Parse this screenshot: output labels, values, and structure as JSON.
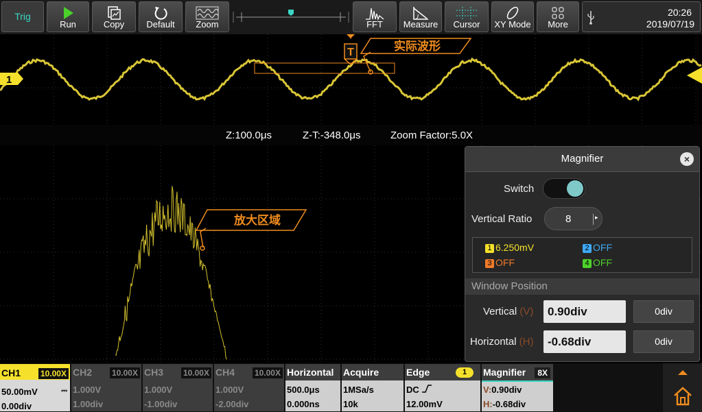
{
  "toolbar": {
    "trig": "Trig",
    "buttons": [
      {
        "label": "Run",
        "icon": "play-icon"
      },
      {
        "label": "Copy",
        "icon": "copy-icon"
      },
      {
        "label": "Default",
        "icon": "reset-icon"
      },
      {
        "label": "Zoom",
        "icon": "zoom-wave-icon"
      },
      {
        "label": "FFT",
        "icon": "fft-icon"
      },
      {
        "label": "Measure",
        "icon": "measure-icon"
      },
      {
        "label": "Cursor",
        "icon": "cursor-icon"
      },
      {
        "label": "XY Mode",
        "icon": "xy-icon"
      },
      {
        "label": "More",
        "icon": "grid-icon"
      }
    ],
    "time": "20:26",
    "date": "2019/07/19"
  },
  "overview": {
    "annotation": "实际波形",
    "trigger_marker": "T",
    "channel_marker": "1"
  },
  "zoom_info": {
    "z": "Z:100.0μs",
    "zt": "Z-T:-348.0μs",
    "factor": "Zoom Factor:5.0X"
  },
  "main": {
    "annotation": "放大区域"
  },
  "magnifier": {
    "title": "Magnifier",
    "switch_label": "Switch",
    "switch_on": true,
    "ratio_label": "Vertical Ratio",
    "ratio_value": "8",
    "channels": [
      {
        "num": "1",
        "value": "6.250mV",
        "color": "#f5e12b"
      },
      {
        "num": "2",
        "value": "OFF",
        "color": "#3fa9f5"
      },
      {
        "num": "3",
        "value": "OFF",
        "color": "#f07a2a"
      },
      {
        "num": "4",
        "value": "OFF",
        "color": "#4ed12a"
      }
    ],
    "section": "Window Position",
    "vertical_label": "Vertical",
    "vertical_key": "(V)",
    "vertical_value": "0.90div",
    "vertical_zero": "0div",
    "horizontal_label": "Horizontal",
    "horizontal_key": "(H)",
    "horizontal_value": "-0.68div",
    "horizontal_zero": "0div"
  },
  "status": {
    "ch1": {
      "name": "CH1",
      "badge": "10.00X",
      "scale": "50.00mV",
      "offset": "0.00div"
    },
    "ch2": {
      "name": "CH2",
      "badge": "10.00X",
      "scale": "1.000V",
      "offset": "1.00div"
    },
    "ch3": {
      "name": "CH3",
      "badge": "10.00X",
      "scale": "1.000V",
      "offset": "-1.00div"
    },
    "ch4": {
      "name": "CH4",
      "badge": "10.00X",
      "scale": "1.000V",
      "offset": "-2.00div"
    },
    "horizontal": {
      "title": "Horizontal",
      "timebase": "500.0μs",
      "delay": "0.000ns"
    },
    "acquire": {
      "title": "Acquire",
      "rate": "1MSa/s",
      "depth": "10k"
    },
    "edge": {
      "title": "Edge",
      "source": "1",
      "coupling": "DC",
      "level": "12.00mV"
    },
    "magnifier": {
      "title": "Magnifier",
      "ratio": "8X",
      "v_key": "V:",
      "v": "0.90div",
      "h_key": "H:",
      "h": "-0.68div"
    }
  },
  "colors": {
    "ch1": "#f5e12b",
    "ch_inactive": "#8a8a8a",
    "accent_orange": "#f08c1e",
    "teal": "#3ad6c4"
  }
}
